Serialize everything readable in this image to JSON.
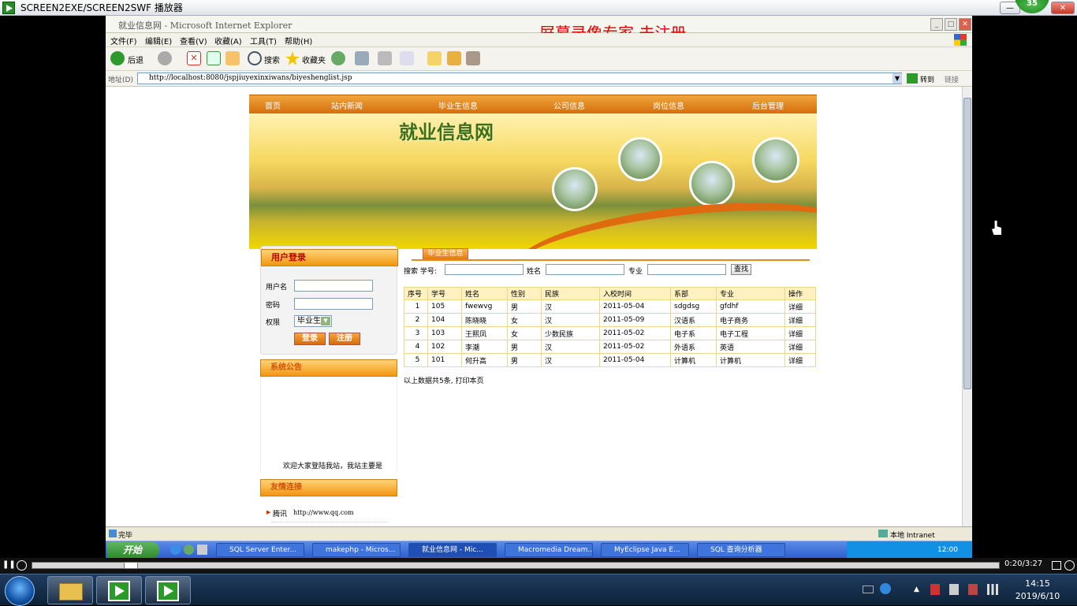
{
  "player": {
    "title": "SCREEN2EXE/SCREEN2SWF 播放器",
    "badge": "35",
    "minimize": "—",
    "close": "✕"
  },
  "ie": {
    "title": "就业信息网 - Microsoft Internet Explorer",
    "watermark": "屏幕录像专家  未注册",
    "menu": [
      "文件(F)",
      "编辑(E)",
      "查看(V)",
      "收藏(A)",
      "工具(T)",
      "帮助(H)"
    ],
    "toolbar": {
      "back": "后退",
      "search": "搜索",
      "favorites": "收藏夹"
    },
    "address_label": "地址(D)",
    "address": "http://localhost:8080/jspjiuyexinxiwans/biyeshenglist.jsp",
    "go": "转到",
    "links": "链接",
    "status_left": "完毕",
    "status_right": "本地 Intranet"
  },
  "site": {
    "nav": [
      "首页",
      "站内新闻",
      "毕业生信息",
      "公司信息",
      "岗位信息",
      "后台管理"
    ],
    "banner_title": "就业信息网",
    "login": {
      "header": "用户登录",
      "username_label": "用户名",
      "password_label": "密码",
      "role_label": "权限",
      "role_value": "毕业生",
      "login_button": "登录",
      "register_button": "注册"
    },
    "notice": {
      "header": "系统公告",
      "text": "欢迎大家登陆我站，我站主要是"
    },
    "friend_links": {
      "header": "友情连接",
      "items": [
        {
          "name": "腾讯",
          "url": "http://www.qq.com"
        }
      ]
    },
    "graduates": {
      "tab": "毕业生信息",
      "search_label": "搜索 学号:",
      "name_label": "姓名",
      "major_label": "专业",
      "find_button": "查找",
      "columns": [
        "序号",
        "学号",
        "姓名",
        "性别",
        "民族",
        "入校时间",
        "系部",
        "专业",
        "操作"
      ],
      "rows": [
        [
          "1",
          "105",
          "fwewvg",
          "男",
          "汉",
          "2011-05-04",
          "sdgdsg",
          "gfdhf",
          "详细"
        ],
        [
          "2",
          "104",
          "陈晓晓",
          "女",
          "汉",
          "2011-05-09",
          "汉语系",
          "电子商务",
          "详细"
        ],
        [
          "3",
          "103",
          "王熙凤",
          "女",
          "少数民族",
          "2011-05-02",
          "电子系",
          "电子工程",
          "详细"
        ],
        [
          "4",
          "102",
          "李潮",
          "男",
          "汉",
          "2011-05-02",
          "外语系",
          "英语",
          "详细"
        ],
        [
          "5",
          "101",
          "何升高",
          "男",
          "汉",
          "2011-05-04",
          "计算机",
          "计算机",
          "详细"
        ]
      ],
      "summary": "以上数据共5条, 打印本页"
    }
  },
  "xp_taskbar": {
    "start": "开始",
    "tasks": [
      "SQL Server Enter...",
      "makephp - Micros...",
      "就业信息网 - Mic...",
      "Macromedia Dream...",
      "MyEclipse Java E...",
      "SQL 查询分析器"
    ],
    "clock": "12:00"
  },
  "win7": {
    "playback_time": "0:20/3:27",
    "clock_time": "14:15",
    "clock_date": "2019/6/10"
  }
}
